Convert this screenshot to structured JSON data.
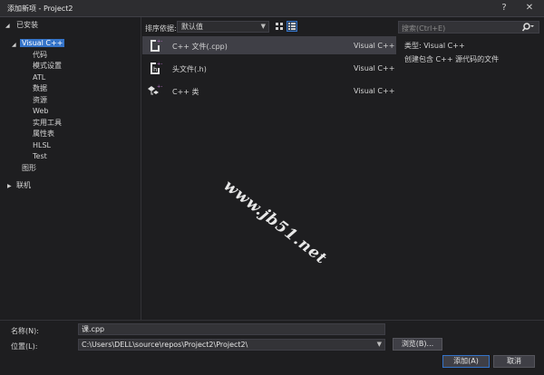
{
  "window": {
    "title": "添加新项 - Project2",
    "help": "?",
    "close": "✕"
  },
  "tree": {
    "installed": "已安装",
    "visual_cpp": "Visual C++",
    "children": [
      "代码",
      "模式设置",
      "ATL",
      "数据",
      "资源",
      "Web",
      "实用工具",
      "属性表",
      "HLSL",
      "Test"
    ],
    "graphics": "图形",
    "online": "联机"
  },
  "toolbar": {
    "sort_label": "排序依据:",
    "sort_value": "默认值"
  },
  "templates": [
    {
      "name": "C++ 文件(.cpp)",
      "category": "Visual C++",
      "icon": "cpp-file-icon"
    },
    {
      "name": "头文件(.h)",
      "category": "Visual C++",
      "icon": "header-file-icon"
    },
    {
      "name": "C++ 类",
      "category": "Visual C++",
      "icon": "cpp-class-icon"
    }
  ],
  "details": {
    "search_placeholder": "搜索(Ctrl+E)",
    "type_label": "类型:  Visual C++",
    "description": "创建包含 C++ 源代码的文件"
  },
  "watermark": "www.jb51.net",
  "form": {
    "name_label": "名称(N):",
    "name_value": "课.cpp",
    "location_label": "位置(L):",
    "location_value": "C:\\Users\\DELL\\source\\repos\\Project2\\Project2\\",
    "browse_label": "浏览(B)...",
    "add_label": "添加(A)",
    "cancel_label": "取消"
  },
  "colors": {
    "accent": "#3574c9",
    "background": "#1e1e20",
    "panel": "#2d2d30"
  }
}
